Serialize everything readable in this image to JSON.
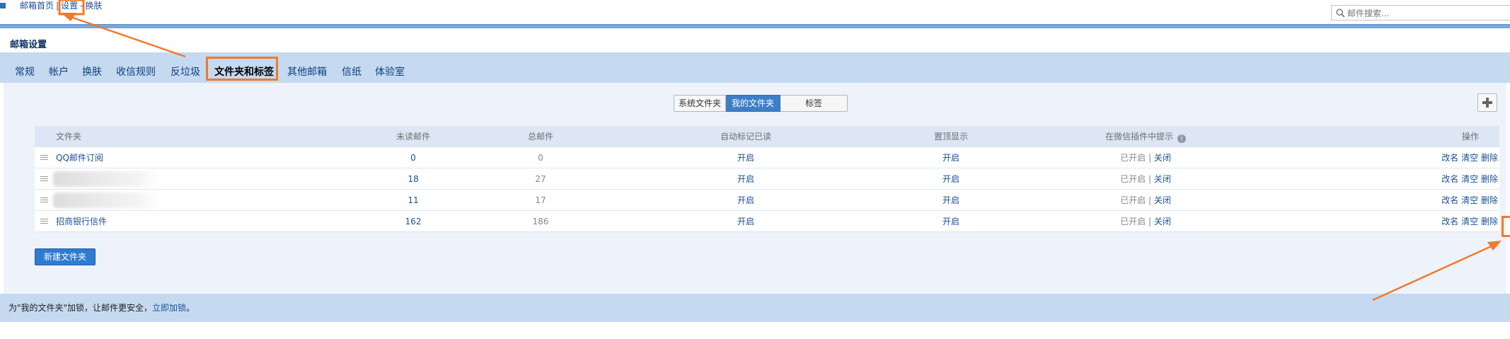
{
  "topnav": {
    "home": "邮箱首页",
    "sep1": "|",
    "settings": "设置",
    "sep2": "-",
    "skin": "换肤"
  },
  "search": {
    "placeholder": "邮件搜索..."
  },
  "page": {
    "title": "邮箱设置"
  },
  "tabs": [
    {
      "label": "常规"
    },
    {
      "label": "帐户"
    },
    {
      "label": "换肤"
    },
    {
      "label": "收信规则"
    },
    {
      "label": "反垃圾"
    },
    {
      "label": "文件夹和标签",
      "active": true
    },
    {
      "label": "其他邮箱"
    },
    {
      "label": "信纸"
    },
    {
      "label": "体验室"
    }
  ],
  "segment": {
    "system": "系统文件夹",
    "mine": "我的文件夹",
    "tags": "标签",
    "selected": "我的文件夹"
  },
  "table": {
    "headers": {
      "folder": "文件夹",
      "unread": "未读邮件",
      "total": "总邮件",
      "auto_mark": "自动标记已读",
      "pin_top": "置顶显示",
      "wechat_hint": "在微信插件中提示",
      "ops": "操作"
    },
    "rows": [
      {
        "name": "QQ邮件订阅",
        "unread": "0",
        "total": "0",
        "auto": "开启",
        "top": "开启",
        "wx_on": "已开启",
        "wx_sep": "|",
        "wx_off": "关闭",
        "rename": "改名",
        "clear": "清空",
        "delete": "删除"
      },
      {
        "name": "",
        "unread": "18",
        "total": "27",
        "auto": "开启",
        "top": "开启",
        "wx_on": "已开启",
        "wx_sep": "|",
        "wx_off": "关闭",
        "rename": "改名",
        "clear": "清空",
        "delete": "删除"
      },
      {
        "name": "",
        "unread": "11",
        "total": "17",
        "auto": "开启",
        "top": "开启",
        "wx_on": "已开启",
        "wx_sep": "|",
        "wx_off": "关闭",
        "rename": "改名",
        "clear": "清空",
        "delete": "删除"
      },
      {
        "name": "招商银行信件",
        "unread": "162",
        "total": "186",
        "auto": "开启",
        "top": "开启",
        "wx_on": "已开启",
        "wx_sep": "|",
        "wx_off": "关闭",
        "rename": "改名",
        "clear": "清空",
        "delete": "删除"
      }
    ]
  },
  "buttons": {
    "new_folder": "新建文件夹"
  },
  "footer": {
    "text": "为\"我的文件夹\"加锁，让邮件更安全，",
    "link": "立即加锁",
    "end": "。"
  },
  "colors": {
    "accent": "#3e7ec7",
    "highlight": "#f07a2a",
    "tab_bar": "#c5daf1"
  },
  "icons": {
    "search": "search-icon",
    "add": "plus-icon",
    "info": "info-icon",
    "drag": "drag-handle-icon"
  }
}
